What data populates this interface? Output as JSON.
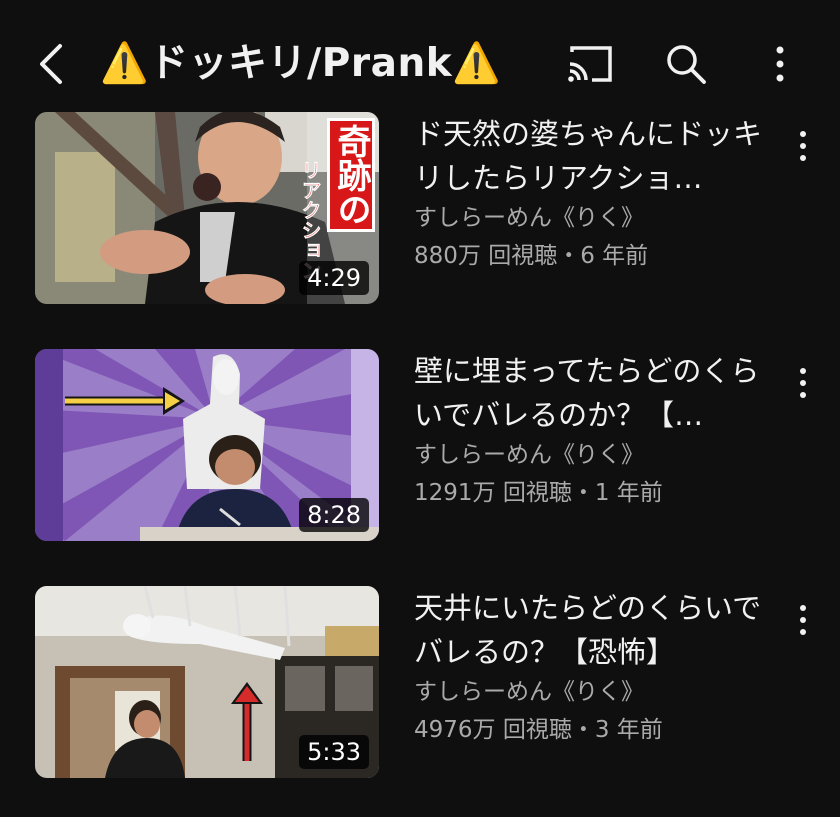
{
  "header": {
    "title": "⚠️ドッキリ/Prank⚠️",
    "icons": [
      "back-arrow-icon",
      "cast-icon",
      "search-icon",
      "more-vertical-icon"
    ]
  },
  "videos": [
    {
      "title": "ド天然の婆ちゃんにドッキリしたらリアクショ…",
      "channel": "すしらーめん《りく》",
      "views": "880万 回視聴",
      "age": "6 年前",
      "duration": "4:29",
      "thumb_caption_1": "奇跡の",
      "thumb_caption_2": "リアクション"
    },
    {
      "title": "壁に埋まってたらどのくらいでバレるのか？【…",
      "channel": "すしらーめん《りく》",
      "views": "1291万 回視聴",
      "age": "1 年前",
      "duration": "8:28"
    },
    {
      "title": "天井にいたらどのくらいでバレるの？【恐怖】",
      "channel": "すしらーめん《りく》",
      "views": "4976万 回視聴",
      "age": "3 年前",
      "duration": "5:33"
    }
  ],
  "stats_separator": "・",
  "colors": {
    "background": "#0f0f0f",
    "text": "#f1f1f1",
    "secondary": "#aaaaaa",
    "warning": "#f5c518"
  }
}
